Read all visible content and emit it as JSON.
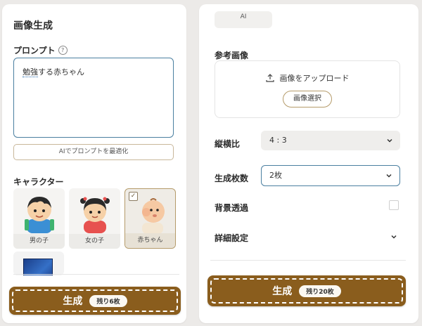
{
  "left_panel": {
    "title": "画像生成",
    "prompt_label": "プロンプト",
    "help_icon_glyph": "?",
    "prompt_value": "勉強する赤ちゃん",
    "prompt_underlined": "勉強",
    "prompt_rest": "する赤ちゃん",
    "optimize_button": "AIでプロンプトを最適化",
    "character_label": "キャラクター",
    "characters": [
      {
        "name": "男の子",
        "icon": "boy-illustration"
      },
      {
        "name": "女の子",
        "icon": "girl-illustration"
      },
      {
        "name": "赤ちゃん",
        "icon": "baby-illustration",
        "selected": true
      }
    ],
    "check_glyph": "✓",
    "generate_label": "生成",
    "remaining": "残り6枚"
  },
  "right_panel": {
    "ai_tag": "AI",
    "reference_label": "参考画像",
    "upload_label": "画像をアップロード",
    "select_image_button": "画像選択",
    "aspect_label": "縦横比",
    "aspect_value": "4 : 3",
    "count_label": "生成枚数",
    "count_value": "2枚",
    "transparent_label": "背景透過",
    "transparent_checked": false,
    "detail_label": "詳細設定",
    "generate_label": "生成",
    "remaining": "残り20枚"
  },
  "colors": {
    "accent_brown": "#8a5d1d",
    "focus_blue": "#4a7fa0",
    "card_border": "#b59b6a"
  }
}
